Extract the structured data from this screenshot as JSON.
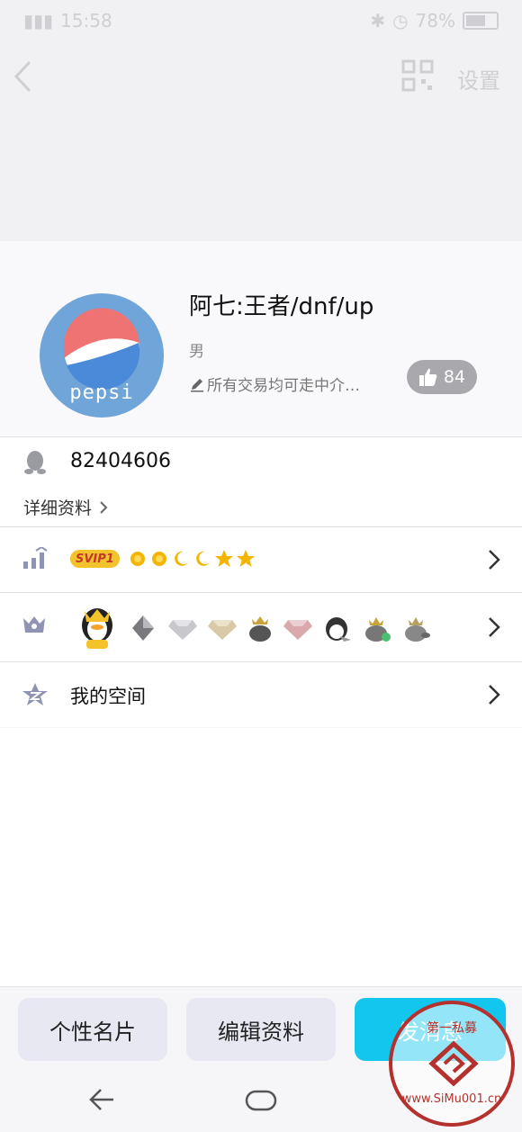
{
  "status_bar": {
    "time": "15:58",
    "battery": "78%"
  },
  "header": {
    "settings_label": "设置"
  },
  "profile": {
    "nickname": "阿七:王者/dnf/up",
    "gender": "男",
    "signature": "所有交易均可走中介…",
    "likes": "84",
    "avatar_text": "pepsi"
  },
  "qq": {
    "number": "82404606",
    "detail_label": "详细资料"
  },
  "vip": {
    "badge": "SVIP1"
  },
  "space": {
    "label": "我的空间"
  },
  "bottom_buttons": {
    "card": "个性名片",
    "edit": "编辑资料",
    "send": "发消息"
  },
  "watermark": {
    "top_text": "第一私募",
    "url": "www.SiMu001.cn"
  },
  "colors": {
    "accent": "#12c6ee",
    "watermark": "#b5312d"
  }
}
